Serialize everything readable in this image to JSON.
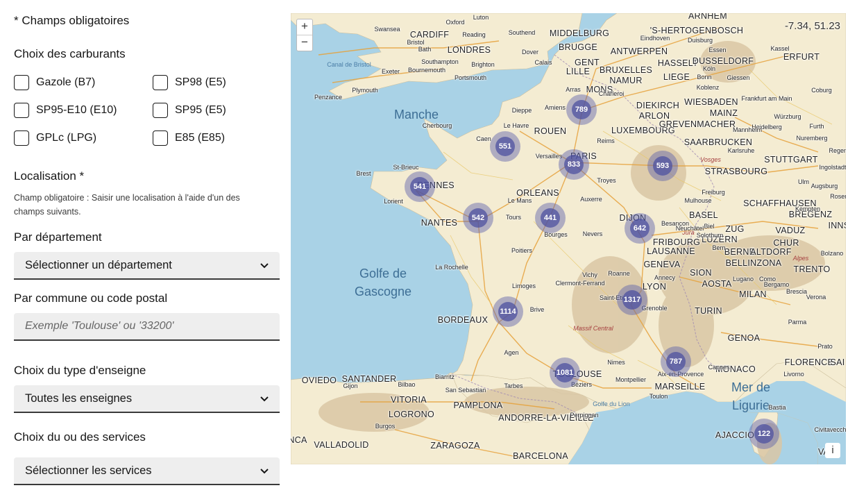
{
  "form": {
    "required_note": "* Champs obligatoires",
    "fuel_title": "Choix des carburants",
    "fuels": [
      "Gazole (B7)",
      "SP98 (E5)",
      "SP95-E10 (E10)",
      "SP95 (E5)",
      "GPLc (LPG)",
      "E85 (E85)"
    ],
    "location_title": "Localisation *",
    "location_hint": "Champ obligatoire : Saisir une localisation à l'aide d'un des champs suivants.",
    "department_title": "Par département",
    "department_select": "Sélectionner un département",
    "commune_title": "Par commune ou code postal",
    "commune_placeholder": "Exemple 'Toulouse' ou '33200'",
    "brand_title": "Choix du type d'enseigne",
    "brand_select": "Toutes les enseignes",
    "services_title": "Choix du ou des services",
    "services_select": "Sélectionner les services"
  },
  "map": {
    "coordinates": "-7.34, 51.23",
    "zoom_in": "+",
    "zoom_out": "−",
    "info": "i",
    "seas": [
      "Manche",
      "Golfe de Gascogne",
      "Mer de Ligurie"
    ],
    "small_seas": [
      "Canal de Bristol",
      "Golfe du Lion"
    ],
    "regions": [
      "Massif Central",
      "Jura",
      "Vosges",
      "Alpes"
    ],
    "big_cities": [
      "CARDIFF",
      "LONDRES",
      "MIDDELBURG",
      "BRUGGE",
      "GENT",
      "BRUXELLES",
      "LILLE",
      "MONS",
      "NAMUR",
      "LIEGE",
      "ANTWERPEN",
      "'S-HERTOGENBOSCH",
      "ARNHEM",
      "HASSELT",
      "DUSSELDORF",
      "ROUEN",
      "PARIS",
      "ORLEANS",
      "NANTES",
      "RENNES",
      "LUXEMBOURG",
      "SAARBRUCKEN",
      "STRASBOURG",
      "STUTTGART",
      "DIJON",
      "BASEL",
      "ZUG",
      "LUZERN",
      "VADUZ",
      "CHUR",
      "BERNE",
      "ALTDORF",
      "LAUSANNE",
      "FRIBOURG",
      "GENEVA",
      "SION",
      "AOSTA",
      "BELLINZONA",
      "LYON",
      "MILAN",
      "TURIN",
      "GENOA",
      "MONACO",
      "FLORENCE",
      "MARSEILLE",
      "BORDEAUX",
      "TOULOUSE",
      "OVIEDO",
      "SANTANDER",
      "VITORIA",
      "PAMPLONA",
      "LOGRONO",
      "ANDORRE-LA-VIEILLE",
      "VALLADOLID",
      "ZARAGOZA",
      "BARCELONA",
      "AJACCIO",
      "DIEKIRCH",
      "ARLON",
      "GREVENMACHER",
      "WIESBADEN",
      "MAINZ",
      "TRENTO",
      "SCHAFFHAUSEN",
      "BREGENZ",
      "ERFURT",
      "SAI",
      "INNS",
      "VAI",
      "NCA"
    ],
    "small_cities": [
      "Swansea",
      "Oxford",
      "Luton",
      "Reading",
      "Southend",
      "Bristol",
      "Bath",
      "Dover",
      "Calais",
      "Southampton",
      "Brighton",
      "Bournemouth",
      "Portsmouth",
      "Exeter",
      "Plymouth",
      "Penzance",
      "Dieppe",
      "Amiens",
      "Arras",
      "Cherbourg",
      "Le Havre",
      "Caen",
      "Versailles",
      "Brest",
      "St-Brieuc",
      "Lorient",
      "Le Mans",
      "Tours",
      "Bourges",
      "Nevers",
      "Auxerre",
      "Troyes",
      "Reims",
      "Charleroi",
      "Besançon",
      "Mulhouse",
      "Freiburg",
      "Karlsruhe",
      "Heidelberg",
      "Mannheim",
      "Frankfurt am Main",
      "Koblenz",
      "Bonn",
      "Köln",
      "Giessen",
      "Kassel",
      "Essen",
      "Eindhoven",
      "Duisburg",
      "Würzburg",
      "Nuremberg",
      "Regensburg",
      "Ingolstadt",
      "Augsburg",
      "Ulm",
      "Kempten",
      "Rosenheim",
      "Coburg",
      "Furth",
      "Poitiers",
      "La Rochelle",
      "Limoges",
      "Clermont-Ferrand",
      "Vichy",
      "Roanne",
      "Saint-Etienne",
      "Grenoble",
      "Annecy",
      "Brive",
      "Agen",
      "Biarritz",
      "San Sebastian",
      "Bilbao",
      "Gijon",
      "Tarbes",
      "Béziers",
      "Montpellier",
      "Nimes",
      "Aix-en-Provence",
      "Toulon",
      "Cannes",
      "Perpignan",
      "Burgos",
      "Lugano",
      "Como",
      "Bergamo",
      "Verona",
      "Brescia",
      "Bolzano",
      "Parma",
      "Livorno",
      "Prato",
      "Bastia",
      "Civitavecchia",
      "Biel",
      "Bern",
      "Neuchâtel",
      "Solothurn"
    ],
    "clusters": [
      {
        "label": "789"
      },
      {
        "label": "551"
      },
      {
        "label": "833"
      },
      {
        "label": "593"
      },
      {
        "label": "541"
      },
      {
        "label": "542"
      },
      {
        "label": "441"
      },
      {
        "label": "642"
      },
      {
        "label": "1114"
      },
      {
        "label": "1317"
      },
      {
        "label": "787"
      },
      {
        "label": "1081"
      },
      {
        "label": "122"
      }
    ],
    "colors": {
      "sea": "#a9d2e6",
      "land": "#f4ecd2",
      "mountain": "#d9c7a5",
      "cluster": "#5c5faa"
    }
  }
}
